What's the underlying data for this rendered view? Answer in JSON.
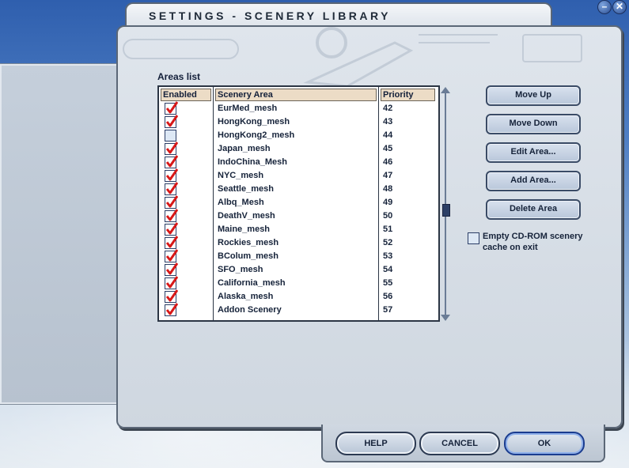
{
  "window": {
    "title": "SETTINGS - SCENERY LIBRARY",
    "minimize_glyph": "–",
    "close_glyph": "✕"
  },
  "areas_list": {
    "label": "Areas list",
    "columns": {
      "enabled": "Enabled",
      "area": "Scenery Area",
      "priority": "Priority"
    },
    "rows": [
      {
        "enabled": true,
        "name": "EurMed_mesh",
        "priority": "42"
      },
      {
        "enabled": true,
        "name": "HongKong_mesh",
        "priority": "43"
      },
      {
        "enabled": false,
        "name": "HongKong2_mesh",
        "priority": "44"
      },
      {
        "enabled": true,
        "name": "Japan_mesh",
        "priority": "45"
      },
      {
        "enabled": true,
        "name": "IndoChina_Mesh",
        "priority": "46"
      },
      {
        "enabled": true,
        "name": "NYC_mesh",
        "priority": "47"
      },
      {
        "enabled": true,
        "name": "Seattle_mesh",
        "priority": "48"
      },
      {
        "enabled": true,
        "name": "Albq_Mesh",
        "priority": "49"
      },
      {
        "enabled": true,
        "name": "DeathV_mesh",
        "priority": "50"
      },
      {
        "enabled": true,
        "name": "Maine_mesh",
        "priority": "51"
      },
      {
        "enabled": true,
        "name": "Rockies_mesh",
        "priority": "52"
      },
      {
        "enabled": true,
        "name": "BColum_mesh",
        "priority": "53"
      },
      {
        "enabled": true,
        "name": "SFO_mesh",
        "priority": "54"
      },
      {
        "enabled": true,
        "name": "California_mesh",
        "priority": "55"
      },
      {
        "enabled": true,
        "name": "Alaska_mesh",
        "priority": "56"
      },
      {
        "enabled": true,
        "name": "Addon Scenery",
        "priority": "57"
      }
    ]
  },
  "buttons": {
    "move_up": "Move Up",
    "move_down": "Move Down",
    "edit_area": "Edit Area...",
    "add_area": "Add Area...",
    "delete_area": "Delete Area"
  },
  "cache_option": {
    "label": "Empty CD-ROM scenery cache on exit",
    "checked": false
  },
  "footer": {
    "help": "HELP",
    "cancel": "CANCEL",
    "ok": "OK"
  },
  "colors": {
    "check_red": "#d81818",
    "accent_blue": "#2a4d92"
  }
}
